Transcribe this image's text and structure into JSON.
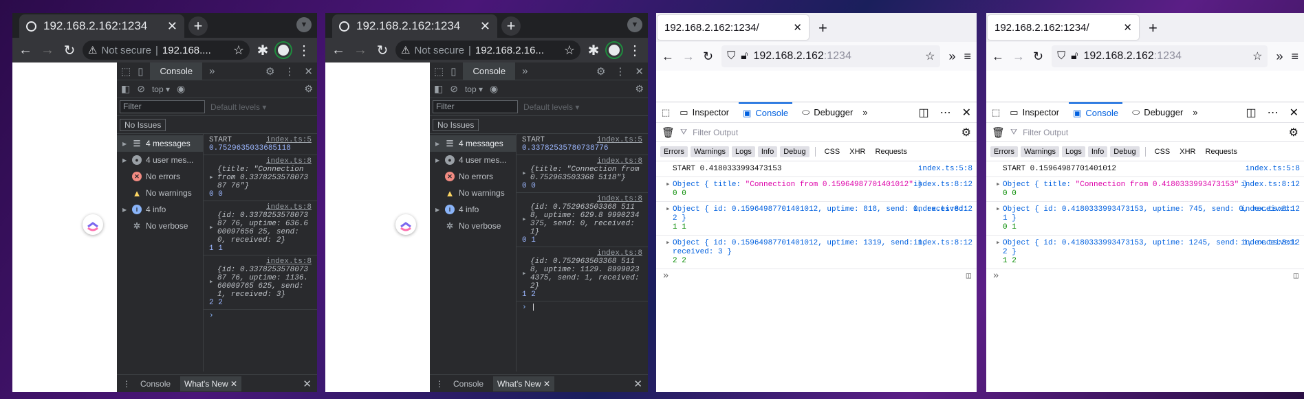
{
  "chrome_windows": [
    {
      "tab_title": "192.168.2.162:1234",
      "omnibox": {
        "not_secure": "Not secure",
        "url": "192.168...."
      },
      "devtools": {
        "tab_console": "Console",
        "context": "top",
        "filter_placeholder": "Filter",
        "levels": "Default levels ▾",
        "issues": "No Issues",
        "sidebar": [
          "4 messages",
          "4 user mes...",
          "No errors",
          "No warnings",
          "4 info",
          "No verbose"
        ],
        "messages": [
          {
            "text": "START",
            "source": "index.ts:5",
            "value": "0.7529635033685118"
          },
          {
            "source": "index.ts:8",
            "obj": "{title: \"Connection from 0.337825357807387 76\"}",
            "count": "0 0"
          },
          {
            "source": "index.ts:8",
            "obj": "{id: 0.337825357807387 76, uptime: 636.600097656 25, send: 0, received: 2}",
            "count": "1 1"
          },
          {
            "source": "index.ts:8",
            "obj": "{id: 0.337825357807387 76, uptime: 1136.60009765 625, send: 1, received: 3}",
            "count": "2 2"
          }
        ],
        "drawer": {
          "console": "Console",
          "whats_new": "What's New"
        }
      }
    },
    {
      "tab_title": "192.168.2.162:1234",
      "omnibox": {
        "not_secure": "Not secure",
        "url": "192.168.2.16..."
      },
      "devtools": {
        "tab_console": "Console",
        "context": "top",
        "filter_placeholder": "Filter",
        "levels": "Default levels ▾",
        "issues": "No Issues",
        "sidebar": [
          "4 messages",
          "4 user mes...",
          "No errors",
          "No warnings",
          "4 info",
          "No verbose"
        ],
        "messages": [
          {
            "text": "START",
            "source": "index.ts:5",
            "value": "0.33782535780738776"
          },
          {
            "source": "index.ts:8",
            "obj": "{title: \"Connection from 0.752963503368 5118\"}",
            "count": "0 0"
          },
          {
            "source": "index.ts:8",
            "obj": "{id: 0.752963503368 5118, uptime: 629.8 9990234375, send: 0, received: 1}",
            "count": "0 1"
          },
          {
            "source": "index.ts:8",
            "obj": "{id: 0.752963503368 5118, uptime: 1129. 89990234375, send: 1, received: 2}",
            "count": "1 2"
          }
        ],
        "drawer": {
          "console": "Console",
          "whats_new": "What's New"
        }
      }
    }
  ],
  "firefox_windows": [
    {
      "tab_title": "192.168.2.162:1234/",
      "url_host": "192.168.2.162",
      "url_port": ":1234",
      "devtools": {
        "tabs": [
          "Inspector",
          "Console",
          "Debugger"
        ],
        "filter_placeholder": "Filter Output",
        "levels": [
          "Errors",
          "Warnings",
          "Logs",
          "Info",
          "Debug"
        ],
        "types": [
          "CSS",
          "XHR",
          "Requests"
        ],
        "messages": [
          {
            "line1": "START 0.4180333993473153",
            "source": "index.ts:5:8"
          },
          {
            "obj_a": "Object { title: ",
            "str": "\"Connection from 0.15964987701401012\"",
            "obj_b": " }",
            "count": "0 0",
            "source": "index.ts:8:12"
          },
          {
            "obj_a": "Object { id: 0.15964987701401012, uptime: 818, send: 0, received: 2 }",
            "count": "1 1",
            "source": "index.ts:8:12"
          },
          {
            "obj_a": "Object { id: 0.15964987701401012, uptime: 1319, send: 1, received: 3 }",
            "count": "2 2",
            "source": "index.ts:8:12"
          }
        ]
      }
    },
    {
      "tab_title": "192.168.2.162:1234/",
      "url_host": "192.168.2.162",
      "url_port": ":1234",
      "devtools": {
        "tabs": [
          "Inspector",
          "Console",
          "Debugger"
        ],
        "filter_placeholder": "Filter Output",
        "levels": [
          "Errors",
          "Warnings",
          "Logs",
          "Info",
          "Debug"
        ],
        "types": [
          "CSS",
          "XHR",
          "Requests"
        ],
        "messages": [
          {
            "line1": "START 0.15964987701401012",
            "source": "index.ts:5:8"
          },
          {
            "obj_a": "Object { title: ",
            "str": "\"Connection from 0.4180333993473153\"",
            "obj_b": " }",
            "count": "0 0",
            "source": "index.ts:8:12"
          },
          {
            "obj_a": "Object { id: 0.4180333993473153, uptime: 745, send: 0, received: 1 }",
            "count": "0 1",
            "source": "index.ts:8:12"
          },
          {
            "obj_a": "Object { id: 0.4180333993473153, uptime: 1245, send: 1, received: 2 }",
            "count": "1 2",
            "source": "index.ts:8:12"
          }
        ]
      }
    }
  ]
}
